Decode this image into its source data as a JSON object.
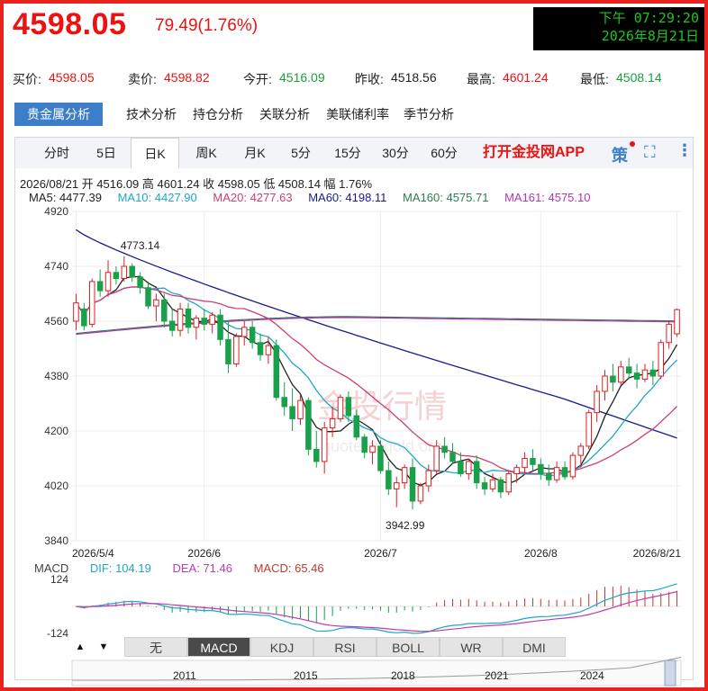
{
  "header": {
    "price": "4598.05",
    "change": "79.49(1.76%)",
    "clock_line1": "下午 07:29:20",
    "clock_line2": "2026年8月21日"
  },
  "quote": {
    "bid_label": "买价:",
    "bid": "4598.05",
    "ask_label": "卖价:",
    "ask": "4598.82",
    "open_label": "今开:",
    "open": "4516.09",
    "prev_label": "昨收:",
    "prev": "4518.56",
    "high_label": "最高:",
    "high": "4601.24",
    "low_label": "最低:",
    "low": "4508.14"
  },
  "nav": {
    "tabs": [
      "贵金属分析",
      "技术分析",
      "持仓分析",
      "关联分析",
      "美联储利率",
      "季节分析"
    ]
  },
  "periods": {
    "tabs": [
      "分时",
      "5日",
      "日K",
      "周K",
      "月K",
      "5分",
      "15分",
      "30分",
      "60分"
    ],
    "active": "日K",
    "app_link": "打开金投网APP",
    "strategy_icon_text": "策"
  },
  "ohlc_line": "2026/08/21  开 4516.09  高 4601.24  收 4598.05  低 4508.14  幅 1.76%",
  "ma_legend": [
    {
      "text": "MA5: 4477.39",
      "color": "#222222"
    },
    {
      "text": "MA10: 4427.90",
      "color": "#1ea7c9"
    },
    {
      "text": "MA20: 4277.63",
      "color": "#cf3d74"
    },
    {
      "text": "MA60: 4198.11",
      "color": "#1a1a8f"
    },
    {
      "text": "MA160: 4575.71",
      "color": "#2e7d4f"
    },
    {
      "text": "MA161: 4575.10",
      "color": "#b534b5"
    }
  ],
  "annotations": {
    "peak": "4773.14",
    "trough": "3942.99",
    "watermark": "金投行情",
    "watermark_url": "quote.cngold.org"
  },
  "macd_legend": [
    {
      "text": "MACD",
      "color": "#444444"
    },
    {
      "text": "DIF: 104.19",
      "color": "#1ea7c9"
    },
    {
      "text": "DEA: 71.46",
      "color": "#c03ab0"
    },
    {
      "text": "MACD: 65.46",
      "color": "#c0392b"
    }
  ],
  "indicator_tabs": [
    "无",
    "MACD",
    "KDJ",
    "RSI",
    "BOLL",
    "WR",
    "DMI"
  ],
  "indicator_active": "MACD",
  "timeline_years": [
    "2011",
    "2015",
    "2018",
    "2021",
    "2024"
  ],
  "colors": {
    "up": "#e11d1d",
    "down": "#19a04a",
    "accent": "#3d7ec9"
  },
  "chart_data": {
    "type": "candlestick",
    "title": "",
    "ylim": [
      3840,
      4920
    ],
    "yticks": [
      4920,
      4740,
      4560,
      4380,
      4200,
      4020,
      3840
    ],
    "xticks": [
      "2026/5/4",
      "2026/6",
      "2026/7",
      "2026/8",
      "2026/8/21"
    ],
    "candles_ohlc": [
      [
        4560,
        4650,
        4530,
        4620
      ],
      [
        4600,
        4620,
        4530,
        4545
      ],
      [
        4550,
        4700,
        4540,
        4690
      ],
      [
        4690,
        4730,
        4640,
        4660
      ],
      [
        4660,
        4760,
        4640,
        4720
      ],
      [
        4720,
        4740,
        4680,
        4700
      ],
      [
        4700,
        4773.14,
        4690,
        4740
      ],
      [
        4740,
        4750,
        4690,
        4705
      ],
      [
        4705,
        4720,
        4650,
        4670
      ],
      [
        4670,
        4690,
        4600,
        4610
      ],
      [
        4610,
        4650,
        4560,
        4630
      ],
      [
        4630,
        4650,
        4540,
        4560
      ],
      [
        4560,
        4600,
        4510,
        4530
      ],
      [
        4530,
        4620,
        4510,
        4600
      ],
      [
        4600,
        4620,
        4520,
        4540
      ],
      [
        4540,
        4580,
        4500,
        4570
      ],
      [
        4570,
        4600,
        4530,
        4550
      ],
      [
        4550,
        4590,
        4520,
        4580
      ],
      [
        4580,
        4600,
        4480,
        4500
      ],
      [
        4500,
        4560,
        4390,
        4420
      ],
      [
        4420,
        4520,
        4410,
        4510
      ],
      [
        4510,
        4560,
        4480,
        4540
      ],
      [
        4540,
        4560,
        4470,
        4490
      ],
      [
        4490,
        4520,
        4430,
        4450
      ],
      [
        4450,
        4510,
        4420,
        4480
      ],
      [
        4480,
        4500,
        4300,
        4310
      ],
      [
        4310,
        4360,
        4250,
        4280
      ],
      [
        4280,
        4340,
        4200,
        4240
      ],
      [
        4240,
        4320,
        4220,
        4300
      ],
      [
        4300,
        4310,
        4120,
        4140
      ],
      [
        4140,
        4200,
        4080,
        4100
      ],
      [
        4100,
        4230,
        4060,
        4210
      ],
      [
        4210,
        4280,
        4180,
        4240
      ],
      [
        4240,
        4320,
        4230,
        4310
      ],
      [
        4310,
        4330,
        4230,
        4250
      ],
      [
        4250,
        4270,
        4170,
        4180
      ],
      [
        4180,
        4190,
        4110,
        4130
      ],
      [
        4130,
        4170,
        4090,
        4150
      ],
      [
        4150,
        4170,
        4060,
        4070
      ],
      [
        4070,
        4100,
        3990,
        4010
      ],
      [
        4010,
        4050,
        3950,
        4030
      ],
      [
        4030,
        4090,
        4010,
        4080
      ],
      [
        4080,
        4110,
        3942.99,
        3970
      ],
      [
        3970,
        4030,
        3960,
        4020
      ],
      [
        4020,
        4090,
        4000,
        4070
      ],
      [
        4070,
        4170,
        4060,
        4150
      ],
      [
        4150,
        4180,
        4110,
        4130
      ],
      [
        4130,
        4160,
        4090,
        4100
      ],
      [
        4100,
        4130,
        4050,
        4060
      ],
      [
        4060,
        4110,
        4040,
        4100
      ],
      [
        4100,
        4120,
        4010,
        4030
      ],
      [
        4030,
        4050,
        3990,
        4010
      ],
      [
        4010,
        4060,
        4000,
        4040
      ],
      [
        4040,
        4050,
        3980,
        4000
      ],
      [
        4000,
        4070,
        3990,
        4060
      ],
      [
        4060,
        4090,
        4030,
        4080
      ],
      [
        4080,
        4130,
        4060,
        4110
      ],
      [
        4110,
        4140,
        4070,
        4090
      ],
      [
        4090,
        4110,
        4040,
        4060
      ],
      [
        4060,
        4090,
        4020,
        4040
      ],
      [
        4040,
        4100,
        4030,
        4080
      ],
      [
        4080,
        4100,
        4040,
        4050
      ],
      [
        4050,
        4130,
        4040,
        4120
      ],
      [
        4120,
        4160,
        4080,
        4150
      ],
      [
        4150,
        4270,
        4140,
        4260
      ],
      [
        4260,
        4350,
        4230,
        4330
      ],
      [
        4330,
        4400,
        4300,
        4380
      ],
      [
        4380,
        4420,
        4330,
        4360
      ],
      [
        4360,
        4430,
        4350,
        4410
      ],
      [
        4410,
        4440,
        4370,
        4390
      ],
      [
        4390,
        4420,
        4340,
        4370
      ],
      [
        4370,
        4420,
        4360,
        4400
      ],
      [
        4400,
        4430,
        4350,
        4380
      ],
      [
        4380,
        4500,
        4370,
        4490
      ],
      [
        4490,
        4560,
        4470,
        4550
      ],
      [
        4518.56,
        4601.24,
        4508.14,
        4598.05
      ]
    ],
    "macd": {
      "ylim": [
        -124,
        124
      ],
      "yticks": [
        124,
        -124
      ],
      "dif": 104.19,
      "dea": 71.46,
      "macd": 65.46
    }
  }
}
